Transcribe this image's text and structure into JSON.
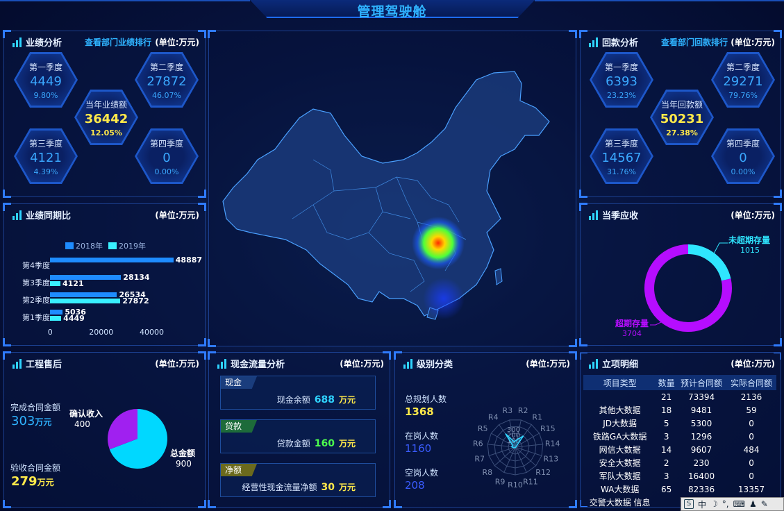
{
  "header": {
    "title": "管理驾驶舱"
  },
  "perf": {
    "title": "业绩分析",
    "link": "查看部门业绩排行",
    "unit": "(单位:万元)",
    "q1": {
      "label": "第一季度",
      "value": "4449",
      "pct": "9.80%"
    },
    "q2": {
      "label": "第二季度",
      "value": "27872",
      "pct": "46.07%"
    },
    "q3": {
      "label": "第三季度",
      "value": "4121",
      "pct": "4.39%"
    },
    "q4": {
      "label": "第四季度",
      "value": "0",
      "pct": "0.00%"
    },
    "total": {
      "label": "当年业绩额",
      "value": "36442",
      "pct": "12.05%"
    }
  },
  "collect": {
    "title": "回款分析",
    "link": "查看部门回款排行",
    "unit": "(单位:万元)",
    "q1": {
      "label": "第一季度",
      "value": "6393",
      "pct": "23.23%"
    },
    "q2": {
      "label": "第二季度",
      "value": "29271",
      "pct": "79.76%"
    },
    "q3": {
      "label": "第三季度",
      "value": "14567",
      "pct": "31.76%"
    },
    "q4": {
      "label": "第四季度",
      "value": "0",
      "pct": "0.00%"
    },
    "total": {
      "label": "当年回款额",
      "value": "50231",
      "pct": "27.38%"
    }
  },
  "yoy": {
    "title": "业绩同期比",
    "unit": "(单位:万元)"
  },
  "receivable": {
    "title": "当季应收",
    "unit": "(单位:万元)"
  },
  "aftersale": {
    "title": "工程售后",
    "unit": "(单位:万元)",
    "done_label": "完成合同金额",
    "done_value": "303",
    "done_unit": "万元",
    "accept_label": "验收合同金额",
    "accept_value": "279",
    "accept_unit": "万元"
  },
  "cashflow": {
    "title": "现金流量分析",
    "unit": "(单位:万元)",
    "rows": [
      {
        "tag": "现金",
        "label": "现金余额",
        "value": "688",
        "u": "万元",
        "color": "#2fd3ff",
        "tagcolor": "#1a3d7d"
      },
      {
        "tag": "贷款",
        "label": "贷款金额",
        "value": "160",
        "u": "万元",
        "color": "#4dff4d",
        "tagcolor": "#1d6b3a"
      },
      {
        "tag": "净额",
        "label": "经营性现金流量净额",
        "value": "30",
        "u": "万元",
        "color": "#ffe94a",
        "tagcolor": "#6b6a1d"
      }
    ]
  },
  "level": {
    "title": "级别分类",
    "unit": "(单位:万元)",
    "planned_label": "总规划人数",
    "planned_value": "1368",
    "onjob_label": "在岗人数",
    "onjob_value": "1160",
    "vacant_label": "空岗人数",
    "vacant_value": "208"
  },
  "project": {
    "title": "立项明细",
    "unit": "(单位:万元)",
    "headers": [
      "项目类型",
      "数量",
      "预计合同额",
      "实际合同额"
    ],
    "rows": [
      [
        "",
        "21",
        "73394",
        "2136"
      ],
      [
        "其他大数据",
        "18",
        "9481",
        "59"
      ],
      [
        "JD大数据",
        "5",
        "5300",
        "0"
      ],
      [
        "铁路GA大数据",
        "3",
        "1296",
        "0"
      ],
      [
        "网信大数据",
        "14",
        "9607",
        "484"
      ],
      [
        "安全大数据",
        "2",
        "230",
        "0"
      ],
      [
        "军队大数据",
        "3",
        "16400",
        "0"
      ],
      [
        "WA大数据",
        "65",
        "82336",
        "13357"
      ]
    ],
    "last_partial": "交警大数据 信息"
  },
  "toolbar": {
    "ime": "中",
    "items": [
      "中",
      "☽",
      "°,",
      "⌨",
      "👤",
      "🔧"
    ]
  },
  "chart_data": [
    {
      "type": "bar",
      "title": "业绩同期比",
      "orientation": "horizontal",
      "categories": [
        "第1季度",
        "第2季度",
        "第3季度",
        "第4季度"
      ],
      "series": [
        {
          "name": "2018年",
          "values": [
            5036,
            26534,
            28134,
            48887
          ],
          "color": "#1e8cff"
        },
        {
          "name": "2019年",
          "values": [
            4449,
            27872,
            4121,
            null
          ],
          "color": "#39f0ff"
        }
      ],
      "xticks": [
        0,
        20000,
        40000
      ],
      "xlim": [
        0,
        55000
      ],
      "legend": "top"
    },
    {
      "type": "pie",
      "title": "当季应收",
      "donut": true,
      "slices": [
        {
          "label": "未超期存量",
          "value": 1015,
          "color": "#2fe6ff"
        },
        {
          "label": "超期存量",
          "value": 3704,
          "color": "#b60dff"
        }
      ]
    },
    {
      "type": "pie",
      "title": "工程售后",
      "slices": [
        {
          "label": "总金额",
          "value": 900,
          "color": "#00d8ff"
        },
        {
          "label": "确认收入",
          "value": 400,
          "color": "#a020f0"
        }
      ]
    },
    {
      "type": "radar",
      "title": "级别分类",
      "axes": [
        "R1",
        "R2",
        "R3",
        "R4",
        "R5",
        "R6",
        "R7",
        "R8",
        "R9",
        "R10",
        "R11",
        "R12",
        "R13",
        "R14",
        "R15"
      ],
      "ticks": [
        "100",
        "200",
        "300"
      ],
      "values": [
        150,
        80,
        60,
        180,
        30,
        40,
        20,
        10,
        5,
        5,
        5,
        5,
        5,
        5,
        10
      ],
      "max": 300
    }
  ]
}
